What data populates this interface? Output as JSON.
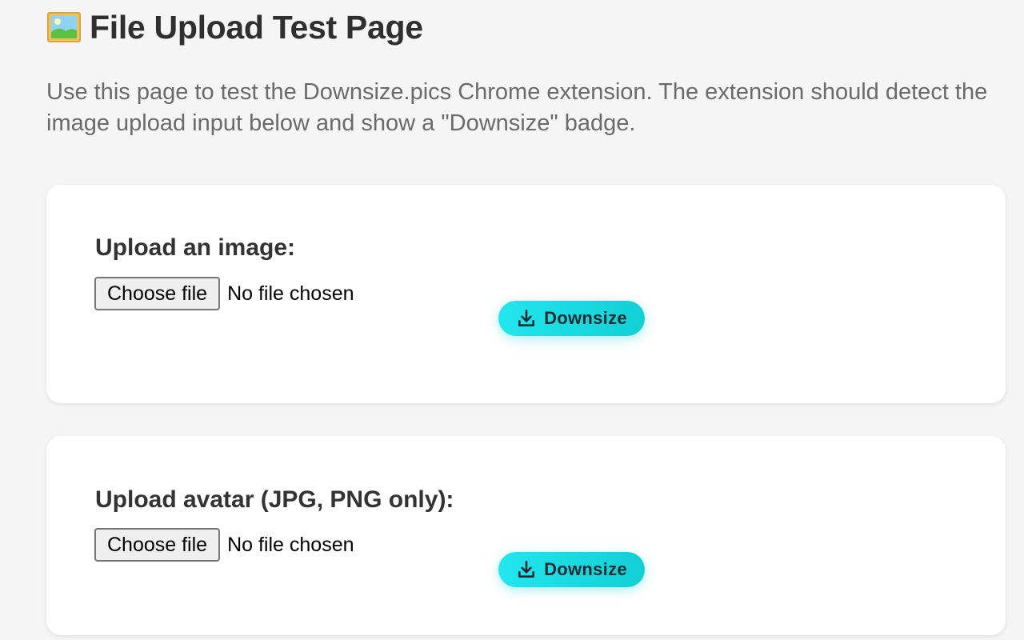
{
  "page": {
    "title": "File Upload Test Page",
    "title_icon": "framed-picture-icon",
    "intro": "Use this page to test the Downsize.pics Chrome extension. The extension should detect the image upload input below and show a \"Downsize\" badge."
  },
  "uploads": [
    {
      "label": "Upload an image:",
      "button_label": "Choose file",
      "status": "No file chosen",
      "badge_label": "Downsize",
      "badge_icon": "download-icon"
    },
    {
      "label": "Upload avatar (JPG, PNG only):",
      "button_label": "Choose file",
      "status": "No file chosen",
      "badge_label": "Downsize",
      "badge_icon": "download-icon"
    }
  ],
  "colors": {
    "background": "#f5f5f5",
    "card": "#ffffff",
    "badge_start": "#22e6ee",
    "badge_end": "#12cfd4",
    "badge_text": "#1c2b33"
  }
}
